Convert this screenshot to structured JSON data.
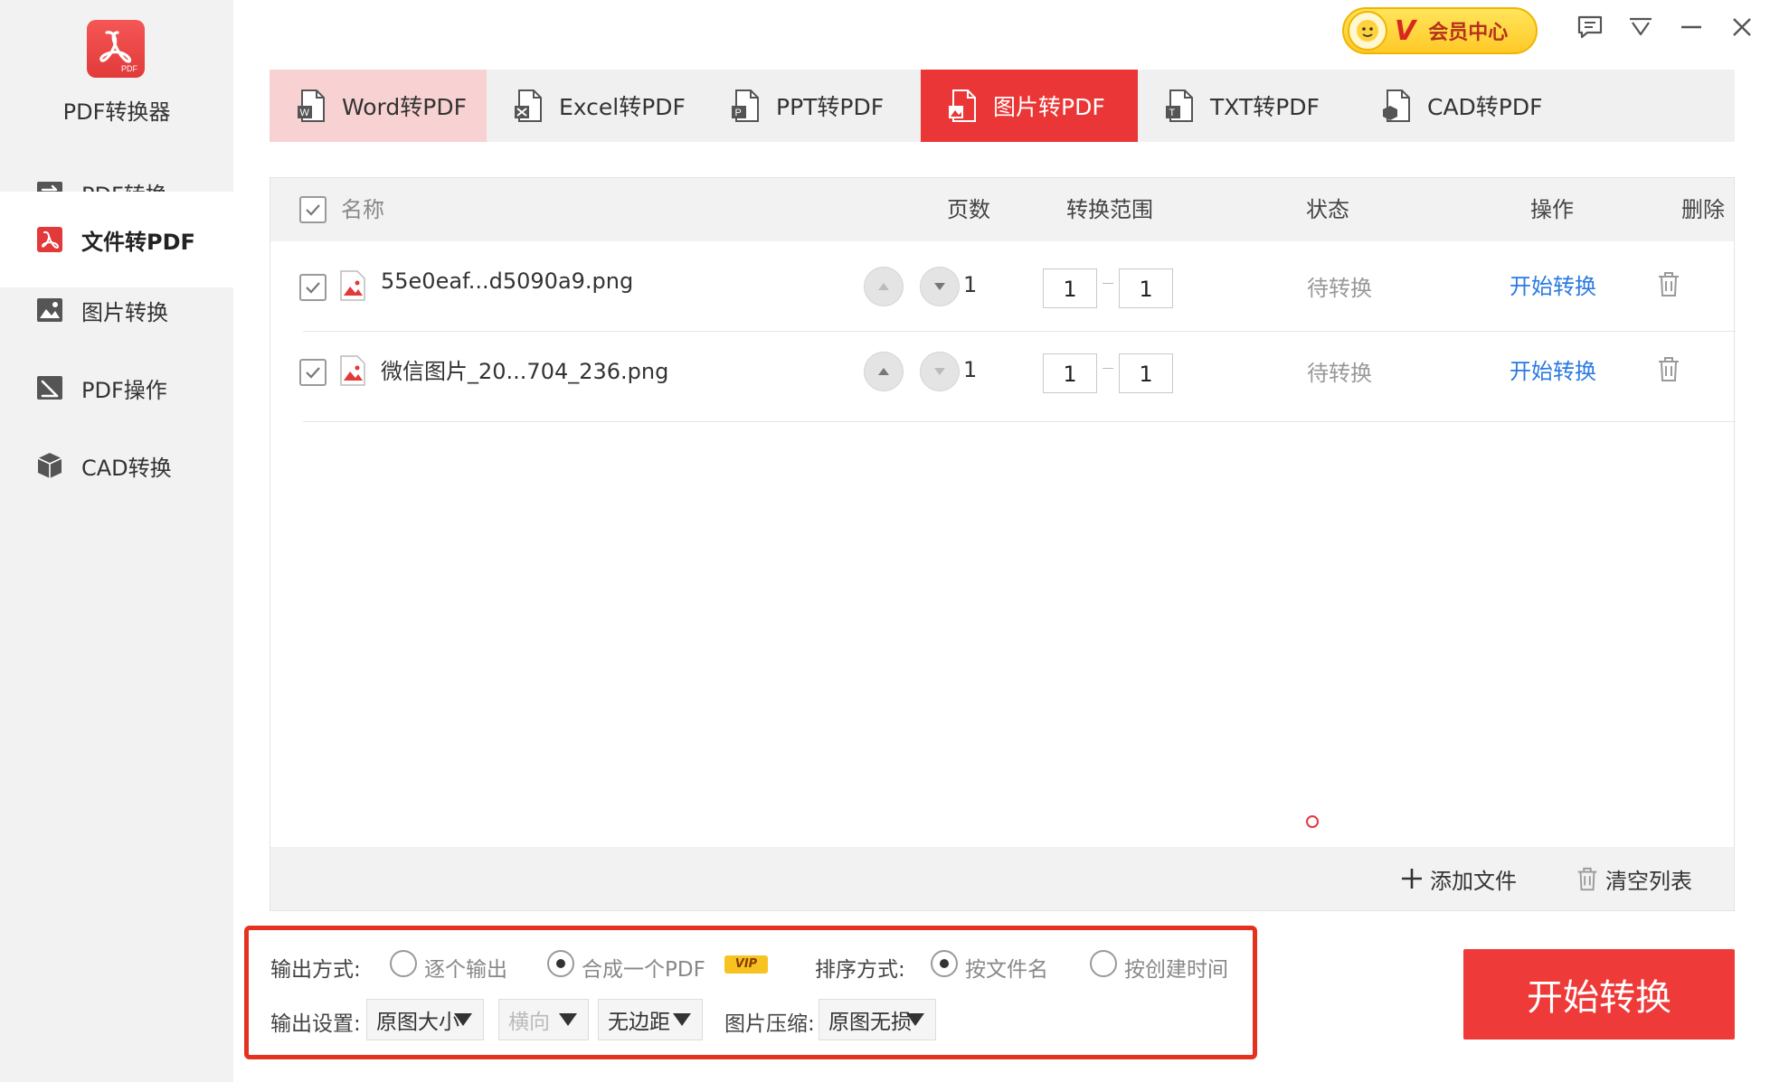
{
  "app": {
    "name": "PDF转换器",
    "logo_text": "PDF"
  },
  "sidebar": {
    "items": [
      {
        "label": "PDF转换",
        "icon": "convert-icon"
      },
      {
        "label": "文件转PDF",
        "icon": "pdf-icon",
        "active": true
      },
      {
        "label": "图片转换",
        "icon": "image-icon"
      },
      {
        "label": "PDF操作",
        "icon": "edit-icon"
      },
      {
        "label": "CAD转换",
        "icon": "cube-icon"
      }
    ]
  },
  "topbar": {
    "vip_label": "会员中心",
    "vip_letter": "V"
  },
  "tabs": [
    {
      "label": "Word转PDF",
      "state": "hover"
    },
    {
      "label": "Excel转PDF"
    },
    {
      "label": "PPT转PDF"
    },
    {
      "label": "图片转PDF",
      "state": "active"
    },
    {
      "label": "TXT转PDF"
    },
    {
      "label": "CAD转PDF"
    }
  ],
  "table": {
    "headers": {
      "name": "名称",
      "pages": "页数",
      "range": "转换范围",
      "status": "状态",
      "action": "操作",
      "delete": "删除"
    },
    "rows": [
      {
        "name": "55e0eaf...d5090a9.png",
        "pages": "1",
        "range_from": "1",
        "range_to": "1",
        "status": "待转换",
        "action": "开始转换",
        "checked": true
      },
      {
        "name": "微信图片_20...704_236.png",
        "pages": "1",
        "range_from": "1",
        "range_to": "1",
        "status": "待转换",
        "action": "开始转换",
        "checked": true
      }
    ],
    "footer": {
      "add_files": "添加文件",
      "clear_list": "清空列表"
    }
  },
  "settings": {
    "output_mode_label": "输出方式:",
    "output_options": [
      "逐个输出",
      "合成一个PDF"
    ],
    "output_selected": "合成一个PDF",
    "vip_tag": "VIP",
    "sort_label": "排序方式:",
    "sort_options": [
      "按文件名",
      "按创建时间"
    ],
    "sort_selected": "按文件名",
    "output_settings_label": "输出设置:",
    "page_size": "原图大小",
    "orientation": "横向",
    "margin": "无边距",
    "compress_label": "图片压缩:",
    "compress": "原图无损"
  },
  "start_button": "开始转换",
  "colors": {
    "accent": "#ea3636",
    "link": "#2a7ae2",
    "vip": "#ffc928"
  }
}
